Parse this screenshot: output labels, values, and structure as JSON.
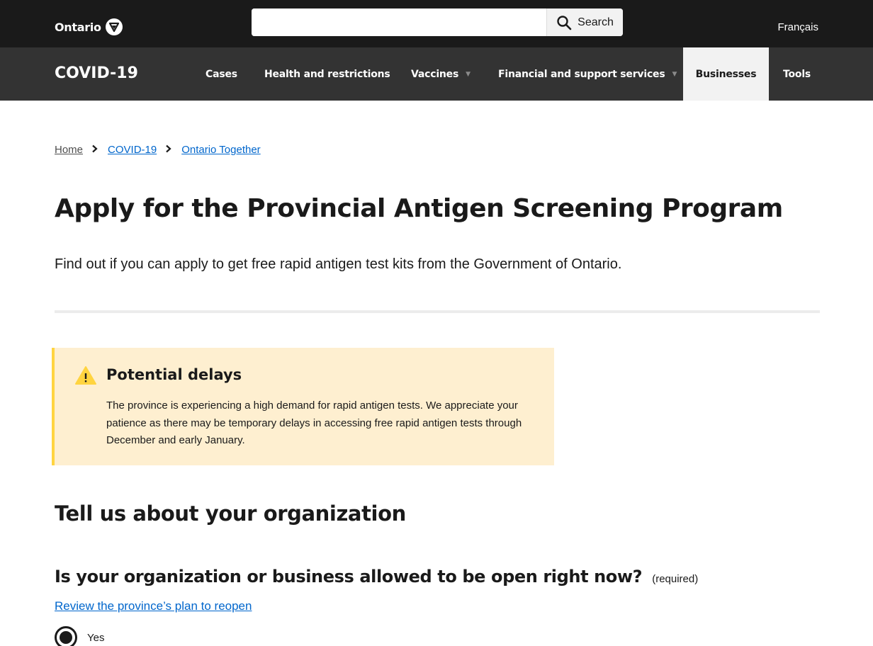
{
  "header": {
    "logo_text": "Ontario",
    "search_placeholder": "",
    "search_label": "Search",
    "language_link": "Français"
  },
  "nav": {
    "brand": "COVID-19",
    "items": [
      {
        "label": "Cases"
      },
      {
        "label": "Health and restrictions"
      },
      {
        "label": "Vaccines"
      },
      {
        "label": "Financial and support services"
      },
      {
        "label": "Businesses"
      },
      {
        "label": "Tools"
      }
    ]
  },
  "breadcrumb": {
    "items": [
      "Home",
      "COVID-19",
      "Ontario Together"
    ]
  },
  "page": {
    "title": "Apply for the Provincial Antigen Screening Program",
    "lead": "Find out if you can apply to get free rapid antigen test kits from the Government of Ontario."
  },
  "alert": {
    "title": "Potential delays",
    "body": "The province is experiencing a high demand for rapid antigen tests. We appreciate your patience as there may be temporary delays in accessing free rapid antigen tests through December and early January."
  },
  "form": {
    "section_title": "Tell us about your organization",
    "question": "Is your organization or business allowed to be open right now?",
    "required_label": "(required)",
    "help_link": "Review the province’s plan to reopen",
    "options": [
      {
        "label": "Yes",
        "selected": true
      }
    ]
  },
  "colors": {
    "header_bg": "#1a1a1a",
    "nav_bg": "#333333",
    "link": "#0066cc",
    "alert_bg": "#feefd0",
    "alert_border": "#ffd440"
  }
}
